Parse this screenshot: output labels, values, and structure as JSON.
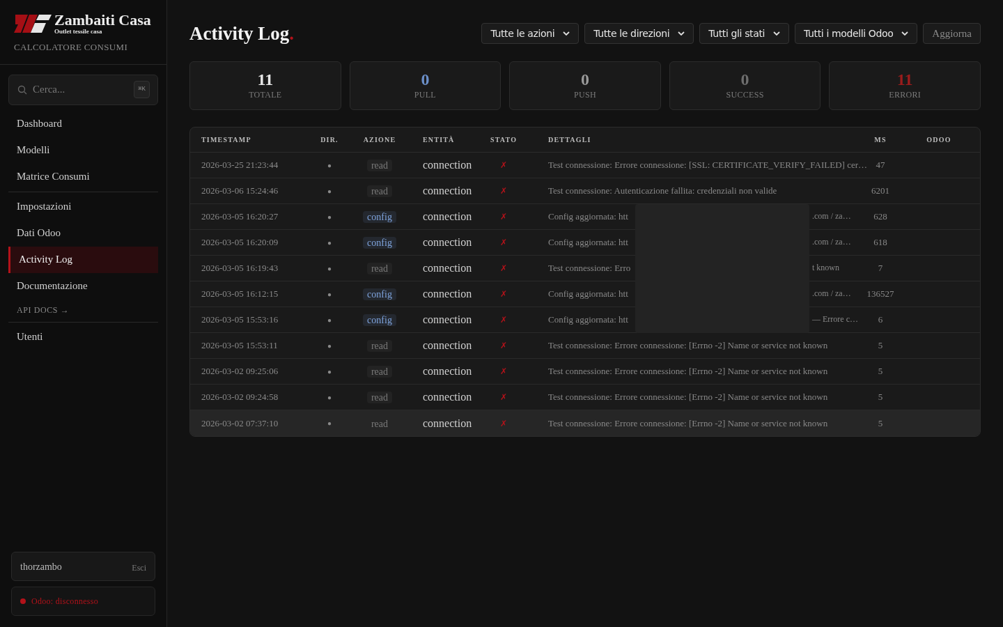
{
  "brand": {
    "name": "Zambaiti Casa",
    "tagline": "Outlet tessile casa",
    "subtitle": "CALCOLATORE CONSUMI"
  },
  "search": {
    "placeholder": "Cerca...",
    "shortcut": "⌘K"
  },
  "nav": [
    {
      "label": "Dashboard",
      "kind": "item",
      "selected": false
    },
    {
      "label": "Modelli",
      "kind": "item",
      "selected": false
    },
    {
      "label": "Matrice Consumi",
      "kind": "item",
      "selected": false
    },
    {
      "kind": "divider"
    },
    {
      "label": "Impostazioni",
      "kind": "item",
      "selected": false
    },
    {
      "label": "Dati Odoo",
      "kind": "item",
      "selected": false
    },
    {
      "label": "Activity Log",
      "kind": "item",
      "selected": true
    },
    {
      "label": "Documentazione",
      "kind": "item",
      "selected": false
    },
    {
      "label": "API DOCS →",
      "kind": "small",
      "selected": false
    },
    {
      "kind": "divider"
    },
    {
      "label": "Utenti",
      "kind": "item",
      "selected": false
    }
  ],
  "user": {
    "name": "thorzambo",
    "logout": "Esci"
  },
  "odoo_status": {
    "label": "Odoo: disconnesso",
    "connected": false
  },
  "page": {
    "title": "Activity Log",
    "title_mark": "."
  },
  "filters": [
    "Tutte le azioni",
    "Tutte le direzioni",
    "Tutti gli stati",
    "Tutti i modelli Odoo"
  ],
  "refresh_button": "Aggiorna",
  "stats": [
    {
      "value": "11",
      "label": "TOTALE",
      "color": "#e8e8e8"
    },
    {
      "value": "0",
      "label": "PULL",
      "color": "#6b8fc9"
    },
    {
      "value": "0",
      "label": "PUSH",
      "color": "#9a9a9a"
    },
    {
      "value": "0",
      "label": "SUCCESS",
      "color": "#6e6e6e"
    },
    {
      "value": "11",
      "label": "ERRORI",
      "color": "#9b1c1c"
    }
  ],
  "table": {
    "columns": [
      "TIMESTAMP",
      "DIR.",
      "AZIONE",
      "ENTITÀ",
      "STATO",
      "DETTAGLI",
      "MS",
      "ODOO"
    ],
    "rows": [
      {
        "timestamp": "2026-03-25 21:23:44",
        "dir": "●",
        "action": "read",
        "kind": "muted",
        "entity": "connection",
        "status": "✗",
        "details": "Test connessione: Errore connessione: [SSL: CERTIFICATE_VERIFY_FAILED] cer…",
        "ms": "47",
        "highlighted": false
      },
      {
        "timestamp": "2026-03-06 15:24:46",
        "dir": "●",
        "action": "read",
        "kind": "muted",
        "entity": "connection",
        "status": "✗",
        "details": "Test connessione: Autenticazione fallita: credenziali non valide",
        "ms": "6201",
        "highlighted": false
      },
      {
        "timestamp": "2026-03-05 16:20:27",
        "dir": "●",
        "action": "config",
        "kind": "accent",
        "entity": "connection",
        "status": "✗",
        "details": "Config aggiornata: htt",
        "details_tail": ".com / za…",
        "ms": "628",
        "highlighted": false
      },
      {
        "timestamp": "2026-03-05 16:20:09",
        "dir": "●",
        "action": "config",
        "kind": "accent",
        "entity": "connection",
        "status": "✗",
        "details": "Config aggiornata: htt",
        "details_tail": ".com / za…",
        "ms": "618",
        "highlighted": false
      },
      {
        "timestamp": "2026-03-05 16:19:43",
        "dir": "●",
        "action": "read",
        "kind": "muted",
        "entity": "connection",
        "status": "✗",
        "details": "Test connessione: Erro",
        "details_tail": "t known",
        "ms": "7",
        "highlighted": false
      },
      {
        "timestamp": "2026-03-05 16:12:15",
        "dir": "●",
        "action": "config",
        "kind": "accent",
        "entity": "connection",
        "status": "✗",
        "details": "Config aggiornata: htt",
        "details_tail": ".com / za…",
        "ms": "136527",
        "highlighted": false
      },
      {
        "timestamp": "2026-03-05 15:53:16",
        "dir": "●",
        "action": "config",
        "kind": "accent",
        "entity": "connection",
        "status": "✗",
        "details": "Config aggiornata: htt",
        "details_tail": "— Errore c…",
        "ms": "6",
        "highlighted": false
      },
      {
        "timestamp": "2026-03-05 15:53:11",
        "dir": "●",
        "action": "read",
        "kind": "muted",
        "entity": "connection",
        "status": "✗",
        "details": "Test connessione: Errore connessione: [Errno -2] Name or service not known",
        "ms": "5",
        "highlighted": false
      },
      {
        "timestamp": "2026-03-02 09:25:06",
        "dir": "●",
        "action": "read",
        "kind": "muted",
        "entity": "connection",
        "status": "✗",
        "details": "Test connessione: Errore connessione: [Errno -2] Name or service not known",
        "ms": "5",
        "highlighted": false
      },
      {
        "timestamp": "2026-03-02 09:24:58",
        "dir": "●",
        "action": "read",
        "kind": "muted",
        "entity": "connection",
        "status": "✗",
        "details": "Test connessione: Errore connessione: [Errno -2] Name or service not known",
        "ms": "5",
        "highlighted": false
      },
      {
        "timestamp": "2026-03-02 07:37:10",
        "dir": "●",
        "action": "read",
        "kind": "plain",
        "entity": "connection",
        "status": "✗",
        "details": "Test connessione: Errore connessione: [Errno -2] Name or service not known",
        "ms": "5",
        "highlighted": true
      }
    ]
  }
}
